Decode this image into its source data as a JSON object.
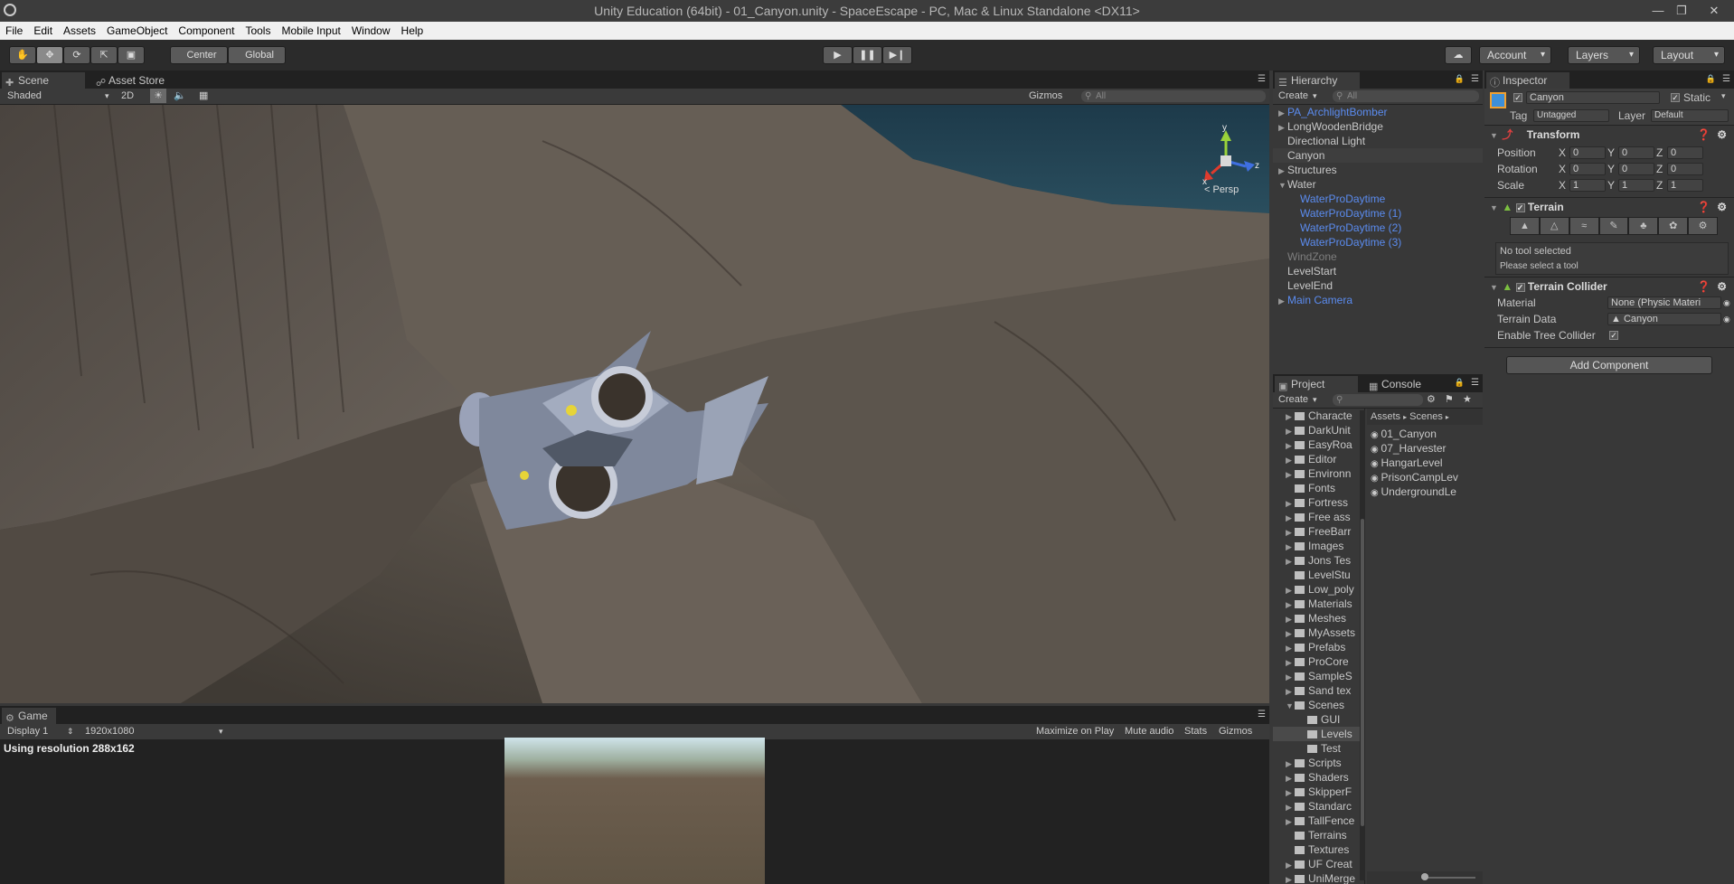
{
  "window": {
    "title": "Unity Education (64bit) - 01_Canyon.unity - SpaceEscape - PC, Mac & Linux Standalone <DX11>"
  },
  "menu": [
    "File",
    "Edit",
    "Assets",
    "GameObject",
    "Component",
    "Tools",
    "Mobile Input",
    "Window",
    "Help"
  ],
  "toolbar": {
    "pivot": "Center",
    "space": "Global",
    "account": "Account",
    "layers": "Layers",
    "layout": "Layout"
  },
  "scene": {
    "tab_scene": "Scene",
    "tab_store": "Asset Store",
    "shading": "Shaded",
    "mode2d": "2D",
    "gizmos": "Gizmos",
    "search_placeholder": "All",
    "persp": "< Persp",
    "axis_y": "y",
    "axis_z": "z",
    "axis_x": "x"
  },
  "game": {
    "tab": "Game",
    "display": "Display 1",
    "resolution": "1920x1080",
    "maximize": "Maximize on Play",
    "mute": "Mute audio",
    "stats": "Stats",
    "gizmos": "Gizmos",
    "using_res": "Using resolution 288x162"
  },
  "hierarchy": {
    "tab": "Hierarchy",
    "create": "Create",
    "search_placeholder": "All",
    "items": [
      {
        "label": "PA_ArchlightBomber",
        "indent": 0,
        "arrow": true,
        "style": "blue"
      },
      {
        "label": "LongWoodenBridge",
        "indent": 0,
        "arrow": true,
        "style": "normal"
      },
      {
        "label": "Directional Light",
        "indent": 0,
        "arrow": false,
        "style": "normal"
      },
      {
        "label": "Canyon",
        "indent": 0,
        "arrow": false,
        "style": "selected"
      },
      {
        "label": "Structures",
        "indent": 0,
        "arrow": true,
        "style": "normal"
      },
      {
        "label": "Water",
        "indent": 0,
        "arrow": "open",
        "style": "normal"
      },
      {
        "label": "WaterProDaytime",
        "indent": 1,
        "arrow": false,
        "style": "blue"
      },
      {
        "label": "WaterProDaytime (1)",
        "indent": 1,
        "arrow": false,
        "style": "blue"
      },
      {
        "label": "WaterProDaytime (2)",
        "indent": 1,
        "arrow": false,
        "style": "blue"
      },
      {
        "label": "WaterProDaytime (3)",
        "indent": 1,
        "arrow": false,
        "style": "blue"
      },
      {
        "label": "WindZone",
        "indent": 0,
        "arrow": false,
        "style": "gray"
      },
      {
        "label": "LevelStart",
        "indent": 0,
        "arrow": false,
        "style": "normal"
      },
      {
        "label": "LevelEnd",
        "indent": 0,
        "arrow": false,
        "style": "normal"
      },
      {
        "label": "Main Camera",
        "indent": 0,
        "arrow": true,
        "style": "blue"
      }
    ]
  },
  "project": {
    "tab": "Project",
    "console_tab": "Console",
    "create": "Create",
    "breadcrumb_assets": "Assets",
    "breadcrumb_scenes": "Scenes",
    "folders": [
      {
        "label": "Characte",
        "indent": 0,
        "arrow": "closed"
      },
      {
        "label": "DarkUnit",
        "indent": 0,
        "arrow": "closed"
      },
      {
        "label": "EasyRoa",
        "indent": 0,
        "arrow": "closed"
      },
      {
        "label": "Editor",
        "indent": 0,
        "arrow": "closed"
      },
      {
        "label": "Environn",
        "indent": 0,
        "arrow": "closed"
      },
      {
        "label": "Fonts",
        "indent": 0,
        "arrow": "none"
      },
      {
        "label": "Fortress",
        "indent": 0,
        "arrow": "closed"
      },
      {
        "label": "Free ass",
        "indent": 0,
        "arrow": "closed"
      },
      {
        "label": "FreeBarr",
        "indent": 0,
        "arrow": "closed"
      },
      {
        "label": "Images",
        "indent": 0,
        "arrow": "closed"
      },
      {
        "label": "Jons Tes",
        "indent": 0,
        "arrow": "closed"
      },
      {
        "label": "LevelStu",
        "indent": 0,
        "arrow": "none"
      },
      {
        "label": "Low_poly",
        "indent": 0,
        "arrow": "closed"
      },
      {
        "label": "Materials",
        "indent": 0,
        "arrow": "closed"
      },
      {
        "label": "Meshes",
        "indent": 0,
        "arrow": "closed"
      },
      {
        "label": "MyAssets",
        "indent": 0,
        "arrow": "closed"
      },
      {
        "label": "Prefabs",
        "indent": 0,
        "arrow": "closed"
      },
      {
        "label": "ProCore",
        "indent": 0,
        "arrow": "closed"
      },
      {
        "label": "SampleS",
        "indent": 0,
        "arrow": "closed"
      },
      {
        "label": "Sand tex",
        "indent": 0,
        "arrow": "closed"
      },
      {
        "label": "Scenes",
        "indent": 0,
        "arrow": "open"
      },
      {
        "label": "GUI",
        "indent": 1,
        "arrow": "none"
      },
      {
        "label": "Levels",
        "indent": 1,
        "arrow": "none",
        "selected": true
      },
      {
        "label": "Test",
        "indent": 1,
        "arrow": "none"
      },
      {
        "label": "Scripts",
        "indent": 0,
        "arrow": "closed"
      },
      {
        "label": "Shaders",
        "indent": 0,
        "arrow": "closed"
      },
      {
        "label": "SkipperF",
        "indent": 0,
        "arrow": "closed"
      },
      {
        "label": "Standarc",
        "indent": 0,
        "arrow": "closed"
      },
      {
        "label": "TallFence",
        "indent": 0,
        "arrow": "closed"
      },
      {
        "label": "Terrains",
        "indent": 0,
        "arrow": "none"
      },
      {
        "label": "Textures",
        "indent": 0,
        "arrow": "none"
      },
      {
        "label": "UF Creat",
        "indent": 0,
        "arrow": "closed"
      },
      {
        "label": "UniMerge",
        "indent": 0,
        "arrow": "closed"
      }
    ],
    "scenes": [
      "01_Canyon",
      "07_Harvester",
      "HangarLevel",
      "PrisonCampLev",
      "UndergroundLe"
    ]
  },
  "inspector": {
    "tab": "Inspector",
    "object_name": "Canyon",
    "static": "Static",
    "tag_label": "Tag",
    "tag_value": "Untagged",
    "layer_label": "Layer",
    "layer_value": "Default",
    "transform": {
      "title": "Transform",
      "rows": [
        {
          "label": "Position",
          "x": "0",
          "y": "0",
          "z": "0"
        },
        {
          "label": "Rotation",
          "x": "0",
          "y": "0",
          "z": "0"
        },
        {
          "label": "Scale",
          "x": "1",
          "y": "1",
          "z": "1"
        }
      ]
    },
    "terrain": {
      "title": "Terrain",
      "no_tool": "No tool selected",
      "please": "Please select a tool"
    },
    "collider": {
      "title": "Terrain Collider",
      "material_label": "Material",
      "material_value": "None (Physic Materi",
      "data_label": "Terrain Data",
      "data_value": "Canyon",
      "tree_label": "Enable Tree Collider"
    },
    "add_component": "Add Component"
  }
}
